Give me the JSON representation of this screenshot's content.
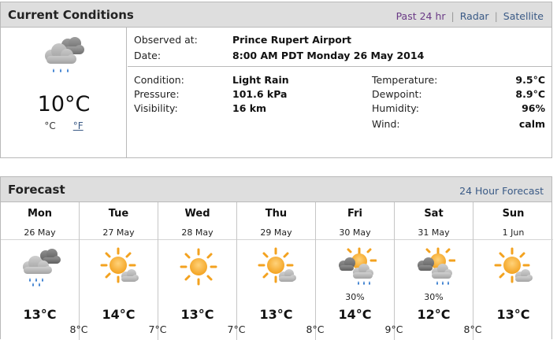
{
  "current": {
    "title": "Current Conditions",
    "links": [
      "Past 24 hr",
      "Radar",
      "Satellite"
    ],
    "temperature_big": "10°C",
    "unit_c": "°C",
    "unit_f": "°F",
    "observed_label": "Observed at:",
    "observed_value": "Prince Rupert Airport",
    "date_label": "Date:",
    "date_value": "8:00 AM PDT Monday 26 May 2014",
    "condition_label": "Condition:",
    "condition_value": "Light Rain",
    "pressure_label": "Pressure:",
    "pressure_value": "101.6 kPa",
    "visibility_label": "Visibility:",
    "visibility_value": "16 km",
    "temperature_label": "Temperature:",
    "temperature_value": "9.5°C",
    "dewpoint_label": "Dewpoint:",
    "dewpoint_value": "8.9°C",
    "humidity_label": "Humidity:",
    "humidity_value": "96%",
    "wind_label": "Wind:",
    "wind_value": "calm",
    "icon": "light-rain-icon"
  },
  "forecast": {
    "title": "Forecast",
    "link": "24 Hour Forecast",
    "days": [
      {
        "name": "Mon",
        "date": "26 May",
        "icon": "rain-icon",
        "pop": "",
        "high": "13°C"
      },
      {
        "name": "Tue",
        "date": "27 May",
        "icon": "sun-cloud-icon",
        "pop": "",
        "high": "14°C"
      },
      {
        "name": "Wed",
        "date": "28 May",
        "icon": "sun-icon",
        "pop": "",
        "high": "13°C"
      },
      {
        "name": "Thu",
        "date": "29 May",
        "icon": "sun-cloud-icon",
        "pop": "",
        "high": "13°C"
      },
      {
        "name": "Fri",
        "date": "30 May",
        "icon": "sun-cloud-rain-icon",
        "pop": "30%",
        "high": "14°C"
      },
      {
        "name": "Sat",
        "date": "31 May",
        "icon": "sun-cloud-rain-icon",
        "pop": "30%",
        "high": "12°C"
      },
      {
        "name": "Sun",
        "date": "1 Jun",
        "icon": "sun-cloud-icon",
        "pop": "",
        "high": "13°C"
      }
    ],
    "lows": [
      "8°C",
      "7°C",
      "7°C",
      "8°C",
      "9°C",
      "8°C"
    ]
  },
  "colors": {
    "header_bg": "#dedede",
    "border": "#b9b9b9",
    "link": "#3a5a86",
    "sun": "#f5a623",
    "cloud": "#9a9a9a",
    "rain": "#3b7fd0"
  }
}
